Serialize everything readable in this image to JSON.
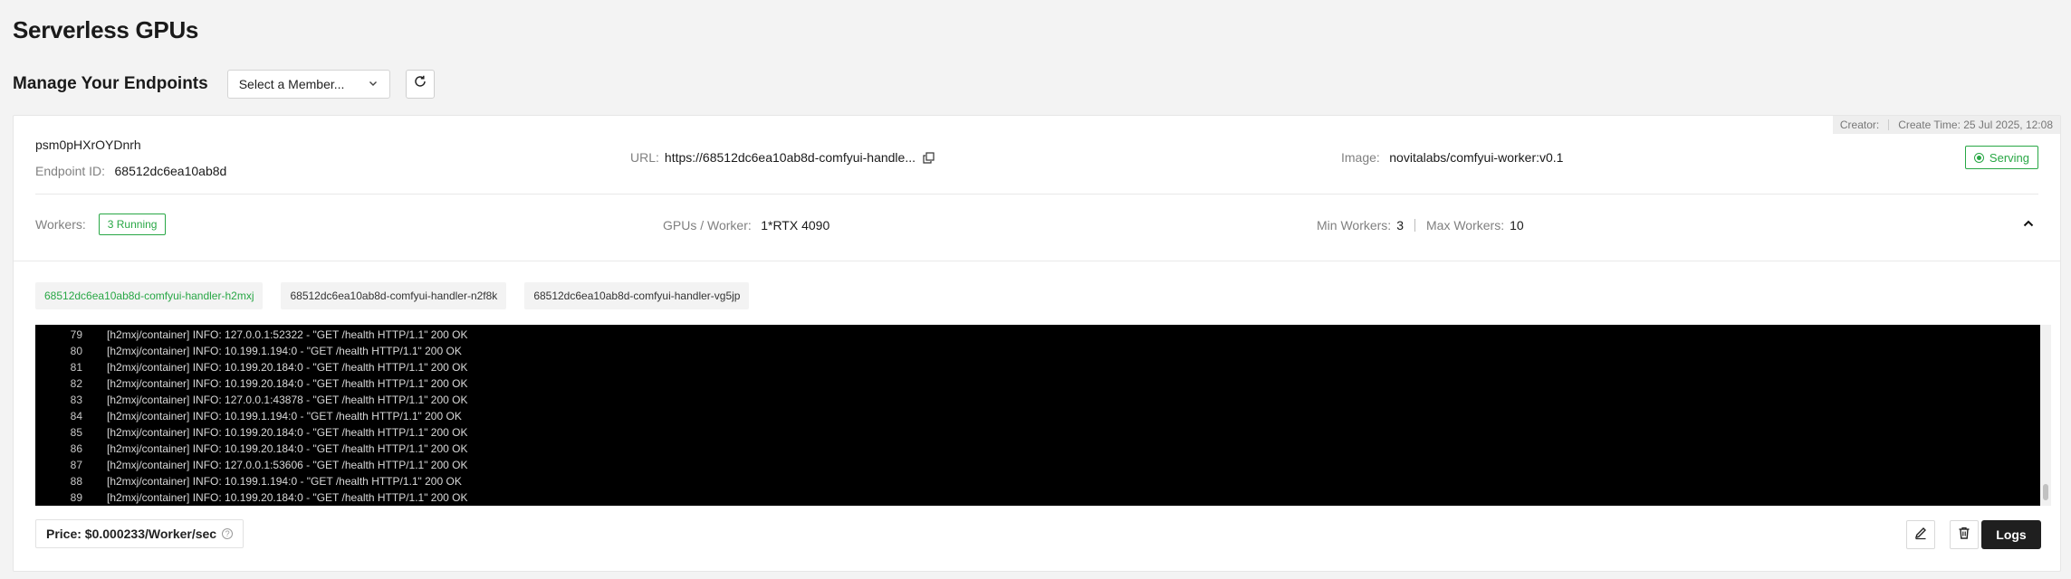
{
  "page": {
    "title": "Serverless GPUs"
  },
  "manage": {
    "title": "Manage Your Endpoints",
    "member_select": "Select a Member..."
  },
  "endpoint": {
    "creator_label": "Creator:",
    "create_time": "Create Time: 25 Jul 2025, 12:08",
    "name": "psm0pHXrOYDnrh",
    "id_label": "Endpoint ID:",
    "id": "68512dc6ea10ab8d",
    "url_label": "URL:",
    "url": "https://68512dc6ea10ab8d-comfyui-handle...",
    "image_label": "Image:",
    "image": "novitalabs/comfyui-worker:v0.1",
    "status": "Serving",
    "workers_label": "Workers:",
    "workers_running": "3 Running",
    "gpus_label": "GPUs / Worker:",
    "gpus": "1*RTX 4090",
    "min_label": "Min Workers:",
    "min": "3",
    "max_label": "Max Workers:",
    "max": "10",
    "price": "Price: $0.000233/Worker/sec",
    "logs_label": "Logs"
  },
  "worker_tabs": [
    "68512dc6ea10ab8d-comfyui-handler-h2mxj",
    "68512dc6ea10ab8d-comfyui-handler-n2f8k",
    "68512dc6ea10ab8d-comfyui-handler-vg5jp"
  ],
  "logs": [
    {
      "n": "79",
      "text": "[h2mxj/container] INFO: 127.0.0.1:52322 - \"GET /health HTTP/1.1\" 200 OK"
    },
    {
      "n": "80",
      "text": "[h2mxj/container] INFO: 10.199.1.194:0 - \"GET /health HTTP/1.1\" 200 OK"
    },
    {
      "n": "81",
      "text": "[h2mxj/container] INFO: 10.199.20.184:0 - \"GET /health HTTP/1.1\" 200 OK"
    },
    {
      "n": "82",
      "text": "[h2mxj/container] INFO: 10.199.20.184:0 - \"GET /health HTTP/1.1\" 200 OK"
    },
    {
      "n": "83",
      "text": "[h2mxj/container] INFO: 127.0.0.1:43878 - \"GET /health HTTP/1.1\" 200 OK"
    },
    {
      "n": "84",
      "text": "[h2mxj/container] INFO: 10.199.1.194:0 - \"GET /health HTTP/1.1\" 200 OK"
    },
    {
      "n": "85",
      "text": "[h2mxj/container] INFO: 10.199.20.184:0 - \"GET /health HTTP/1.1\" 200 OK"
    },
    {
      "n": "86",
      "text": "[h2mxj/container] INFO: 10.199.20.184:0 - \"GET /health HTTP/1.1\" 200 OK"
    },
    {
      "n": "87",
      "text": "[h2mxj/container] INFO: 127.0.0.1:53606 - \"GET /health HTTP/1.1\" 200 OK"
    },
    {
      "n": "88",
      "text": "[h2mxj/container] INFO: 10.199.1.194:0 - \"GET /health HTTP/1.1\" 200 OK"
    },
    {
      "n": "89",
      "text": "[h2mxj/container] INFO: 10.199.20.184:0 - \"GET /health HTTP/1.1\" 200 OK"
    }
  ],
  "colors": {
    "accent": "#28a745",
    "log_bg": "#000000",
    "primary_btn": "#1f1f1f"
  },
  "icons": {
    "member_select": "chevron-down-icon",
    "refresh": "refresh-icon",
    "copy": "copy-icon",
    "serving": "status-dot-icon",
    "collapse": "chevron-up-icon",
    "help": "help-circle-icon",
    "edit": "edit-icon",
    "delete": "trash-icon"
  }
}
